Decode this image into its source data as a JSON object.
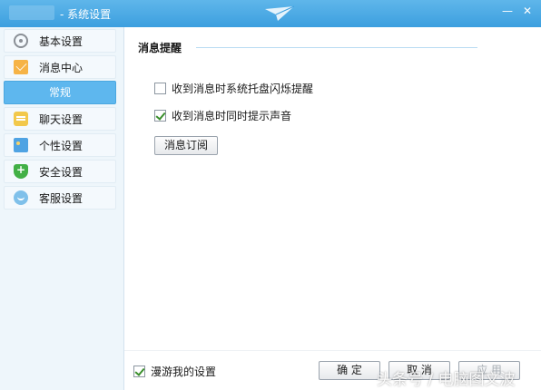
{
  "window": {
    "title": "- 系统设置",
    "minimize": "—",
    "close": "✕"
  },
  "sidebar": {
    "items": [
      {
        "label": "基本设置",
        "icon": "gear-icon"
      },
      {
        "label": "消息中心",
        "icon": "mail-icon"
      },
      {
        "label": "常规",
        "selected": true
      },
      {
        "label": "聊天设置",
        "icon": "chat-icon"
      },
      {
        "label": "个性设置",
        "icon": "personalize-icon"
      },
      {
        "label": "安全设置",
        "icon": "shield-icon"
      },
      {
        "label": "客服设置",
        "icon": "service-icon"
      }
    ]
  },
  "main": {
    "section_title": "消息提醒",
    "options": [
      {
        "label": "收到消息时系统托盘闪烁提醒",
        "checked": false
      },
      {
        "label": "收到消息时同时提示声音",
        "checked": true
      }
    ],
    "subscribe_button": "消息订阅"
  },
  "footer": {
    "roam_label": "漫游我的设置",
    "roam_checked": true,
    "ok_label": "确 定",
    "cancel_label": "取 消",
    "apply_label": "应 用"
  },
  "watermark": "头条号 / 电脑图文波",
  "colors": {
    "titlebar": "#3c9fdf",
    "selected": "#5eb7ee",
    "sidebar_bg": "#eef6fb"
  }
}
